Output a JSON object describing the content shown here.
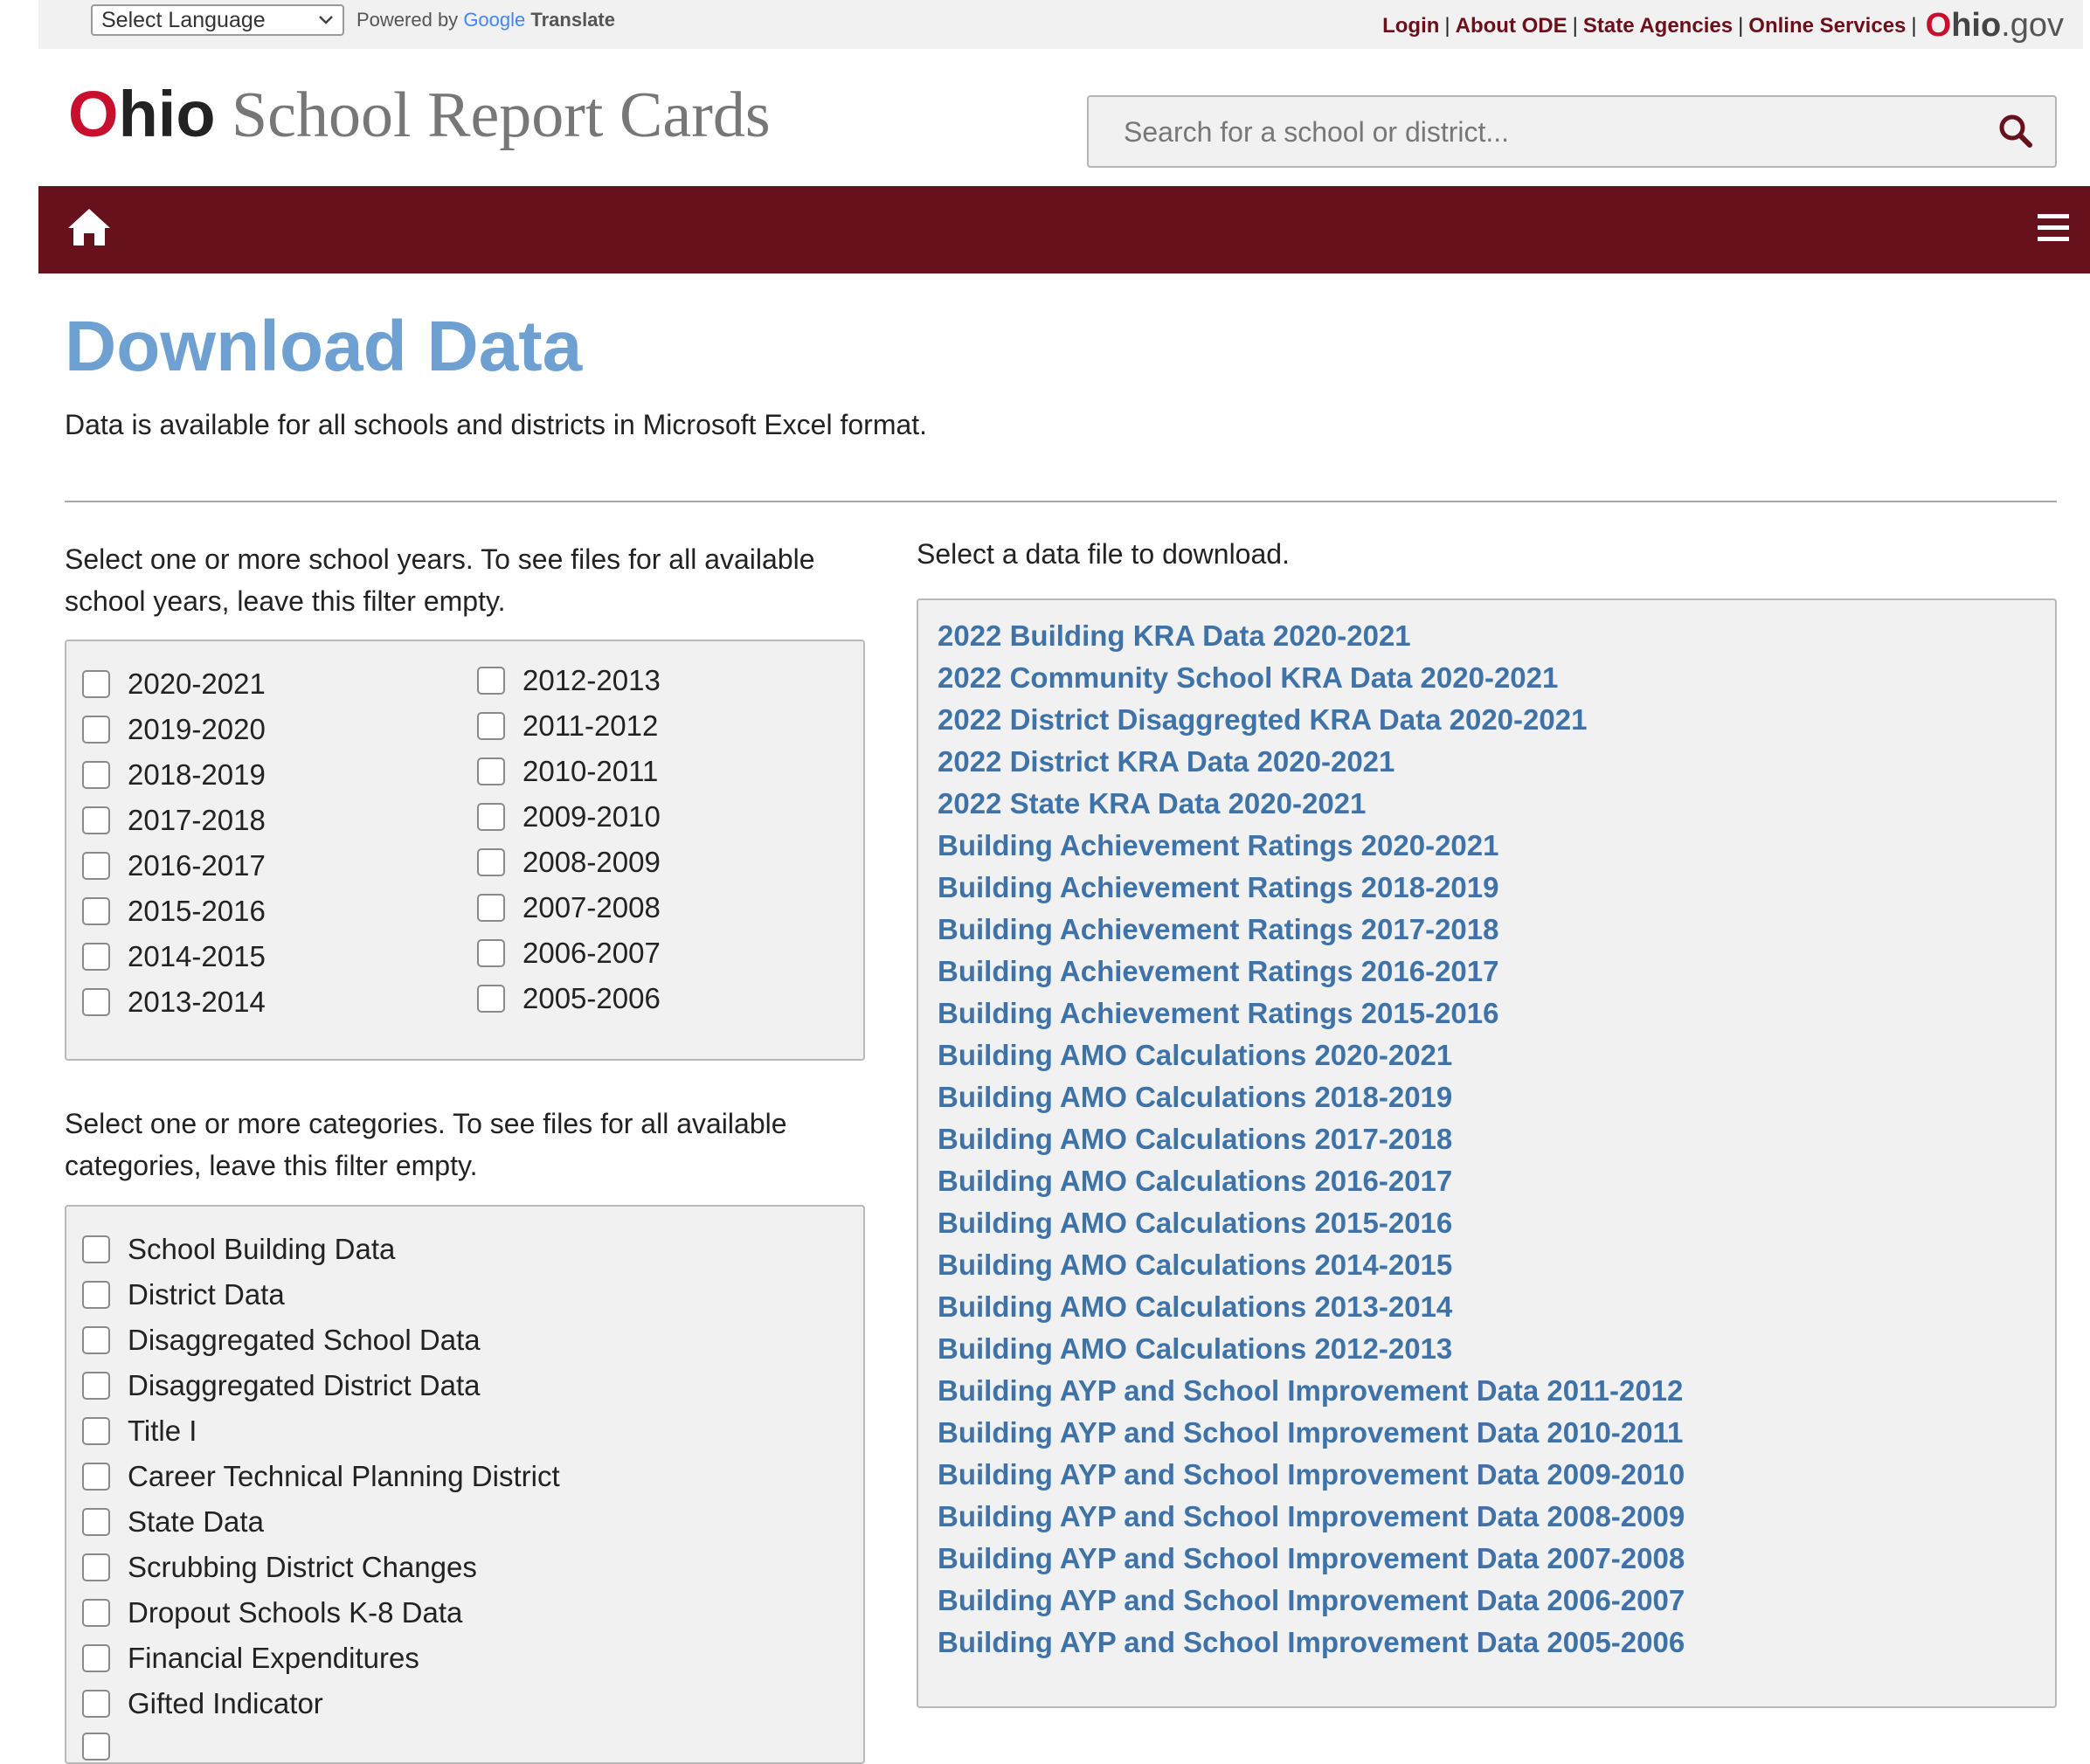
{
  "utility": {
    "language_select": "Select Language",
    "powered_by": "Powered by",
    "google": "Google",
    "translate": "Translate",
    "links": [
      "Login",
      "About ODE",
      "State Agencies",
      "Online Services"
    ],
    "ohio_gov": {
      "o": "O",
      "hio": "hio",
      "gov": ".gov"
    }
  },
  "header": {
    "brand_o": "O",
    "brand_hio": "hio",
    "brand_rest": " School Report Cards",
    "search_placeholder": "Search for a school or district..."
  },
  "page": {
    "title": "Download Data",
    "intro": "Data is available for all schools and districts in Microsoft Excel format."
  },
  "years_filter": {
    "label": "Select one or more school years. To see files for all available school years, leave this filter empty.",
    "col1": [
      "2020-2021",
      "2019-2020",
      "2018-2019",
      "2017-2018",
      "2016-2017",
      "2015-2016",
      "2014-2015",
      "2013-2014"
    ],
    "col2": [
      "2012-2013",
      "2011-2012",
      "2010-2011",
      "2009-2010",
      "2008-2009",
      "2007-2008",
      "2006-2007",
      "2005-2006"
    ]
  },
  "categories_filter": {
    "label": "Select one or more categories. To see files for all available categories, leave this filter empty.",
    "items": [
      "School Building Data",
      "District Data",
      "Disaggregated School Data",
      "Disaggregated District Data",
      "Title I",
      "Career Technical Planning District",
      "State Data",
      "Scrubbing District Changes",
      "Dropout Schools K-8 Data",
      "Financial Expenditures",
      "Gifted Indicator"
    ]
  },
  "files": {
    "label": "Select a data file to download.",
    "items": [
      "2022 Building KRA Data 2020-2021",
      "2022 Community School KRA Data 2020-2021",
      "2022 District Disaggregted KRA Data 2020-2021",
      "2022 District KRA Data 2020-2021",
      "2022 State KRA Data 2020-2021",
      "Building Achievement Ratings 2020-2021",
      "Building Achievement Ratings 2018-2019",
      "Building Achievement Ratings 2017-2018",
      "Building Achievement Ratings 2016-2017",
      "Building Achievement Ratings 2015-2016",
      "Building AMO Calculations 2020-2021",
      "Building AMO Calculations 2018-2019",
      "Building AMO Calculations 2017-2018",
      "Building AMO Calculations 2016-2017",
      "Building AMO Calculations 2015-2016",
      "Building AMO Calculations 2014-2015",
      "Building AMO Calculations 2013-2014",
      "Building AMO Calculations 2012-2013",
      "Building AYP and School Improvement Data 2011-2012",
      "Building AYP and School Improvement Data 2010-2011",
      "Building AYP and School Improvement Data 2009-2010",
      "Building AYP and School Improvement Data 2008-2009",
      "Building AYP and School Improvement Data 2007-2008",
      "Building AYP and School Improvement Data 2006-2007",
      "Building AYP and School Improvement Data 2005-2006"
    ]
  },
  "colors": {
    "maroon": "#66111b",
    "title_blue": "#6ea1d2",
    "link_blue": "#3f73a8",
    "ohio_red": "#c8102e"
  },
  "icons": [
    "chevron-down-icon",
    "search-icon",
    "home-icon",
    "menu-icon"
  ]
}
